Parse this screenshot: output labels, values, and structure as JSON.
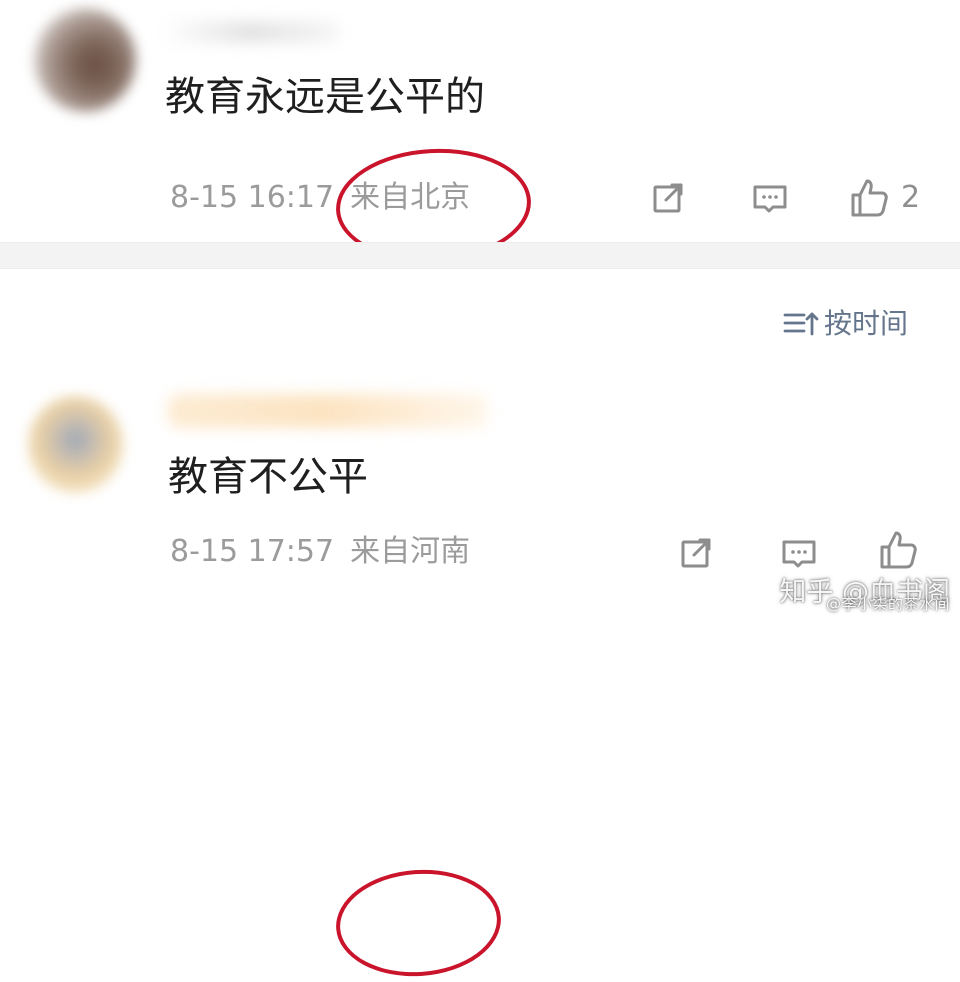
{
  "comments": [
    {
      "text": "教育永远是公平的",
      "time": "8-15 16:17",
      "location": "来自北京",
      "likes": "2",
      "avatar_icon": "blurred-avatar",
      "name_icon": "blurred-username",
      "actions": [
        "share-icon",
        "reply-icon",
        "like-icon"
      ]
    },
    {
      "text": "教育不公平",
      "time": "8-15 17:57",
      "location": "来自河南",
      "likes": "",
      "avatar_icon": "blurred-avatar",
      "name_icon": "blurred-username",
      "actions": [
        "share-icon",
        "reply-icon",
        "like-icon"
      ]
    }
  ],
  "sort": {
    "label": "按时间",
    "icon": "sort-icon"
  },
  "watermark": {
    "main": "知乎 @血书阁",
    "sub": "@李小柒的茶水间"
  },
  "colors": {
    "text": "#1f1f1f",
    "meta": "#9b9b9b",
    "action": "#8d8d8d",
    "sort": "#65768c",
    "circle": "#c9142b",
    "separator": "#f3f3f3"
  }
}
